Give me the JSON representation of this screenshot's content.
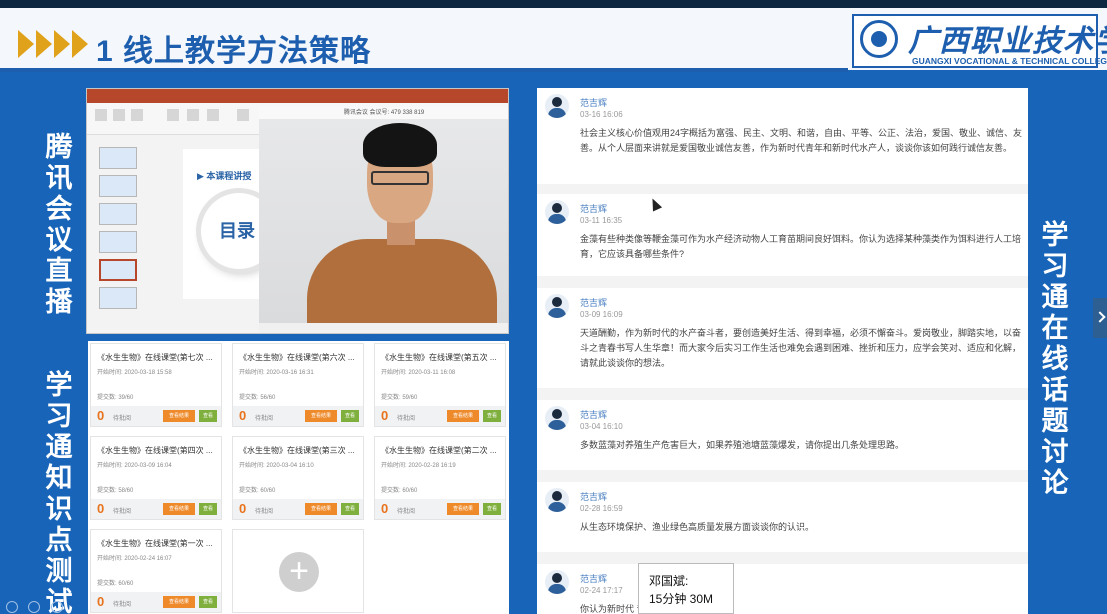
{
  "header": {
    "title": "1 线上教学方法策略",
    "logo_cn": "广西职业技术学院",
    "logo_en": "GUANGXI VOCATIONAL & TECHNICAL COLLEGE"
  },
  "labels": {
    "left_top": "腾讯会议直播",
    "left_bottom": "学习通知识点测试",
    "right": "学习通在线话题讨论"
  },
  "meeting": {
    "slide_heading": "▶ 本课程讲授",
    "slide_circle": "目录",
    "video_header": "腾讯会议 会议号: 479 338 819"
  },
  "quiz": {
    "cards": [
      {
        "title": "《水生生物》在线课堂(第七次 ...",
        "time": "开始时间: 2020-03-18 15:58",
        "sub": "提交数: 39/60",
        "zero": "0",
        "pending": "待批阅",
        "btn1": "查看结果",
        "btn2": "查看"
      },
      {
        "title": "《水生生物》在线课堂(第六次 ...",
        "time": "开始时间: 2020-03-16 16:31",
        "sub": "提交数: 56/60",
        "zero": "0",
        "pending": "待批阅",
        "btn1": "查看结果",
        "btn2": "查看"
      },
      {
        "title": "《水生生物》在线课堂(第五次 ...",
        "time": "开始时间: 2020-03-11 16:08",
        "sub": "提交数: 59/60",
        "zero": "0",
        "pending": "待批阅",
        "btn1": "查看结果",
        "btn2": "查看"
      },
      {
        "title": "《水生生物》在线课堂(第四次 ...",
        "time": "开始时间: 2020-03-09 16:04",
        "sub": "提交数: 58/60",
        "zero": "0",
        "pending": "待批阅",
        "btn1": "查看结果",
        "btn2": "查看"
      },
      {
        "title": "《水生生物》在线课堂(第三次 ...",
        "time": "开始时间: 2020-03-04 16:10",
        "sub": "提交数: 60/60",
        "zero": "0",
        "pending": "待批阅",
        "btn1": "查看结果",
        "btn2": "查看"
      },
      {
        "title": "《水生生物》在线课堂(第二次 ...",
        "time": "开始时间: 2020-02-28 16:19",
        "sub": "提交数: 60/60",
        "zero": "0",
        "pending": "待批阅",
        "btn1": "查看结果",
        "btn2": "查看"
      },
      {
        "title": "《水生生物》在线课堂(第一次 ...",
        "time": "开始时间: 2020-02-24 16:07",
        "sub": "提交数: 60/60",
        "zero": "0",
        "pending": "待批阅",
        "btn1": "查看结果",
        "btn2": "查看"
      }
    ],
    "add_symbol": "+"
  },
  "discussion": {
    "posts": [
      {
        "name": "范吉辉",
        "date": "03-16 16:06",
        "text": "社会主义核心价值观用24字概括为富强、民主、文明、和谐，自由、平等、公正、法治，爱国、敬业、诚信、友善。从个人层面来讲就是爱国敬业诚信友善，作为新时代青年和新时代水产人，谈谈你该如何践行诚信友善。"
      },
      {
        "name": "范吉辉",
        "date": "03-11 16:35",
        "text": "金藻有些种类像等鞭金藻可作为水产经济动物人工育苗期间良好饵料。你认为选择某种藻类作为饵料进行人工培育，它应该具备哪些条件?"
      },
      {
        "name": "范吉辉",
        "date": "03-09 16:09",
        "text": "天道酬勤，作为新时代的水产奋斗者，要创造美好生活、得到幸福，必须不懈奋斗。爱岗敬业，脚踏实地，以奋斗之青春书写人生华章！而大家今后实习工作生活也难免会遇到困难、挫折和压力，应学会笑对、适应和化解，请就此谈谈你的想法。"
      },
      {
        "name": "范吉辉",
        "date": "03-04 16:10",
        "text": "多数蓝藻对养殖生产危害巨大，如果养殖池塘蓝藻爆发，请你提出几条处理思路。"
      },
      {
        "name": "范吉辉",
        "date": "02-28 16:59",
        "text": "从生态环境保护、渔业绿色高质量发展方面谈谈你的认识。"
      },
      {
        "name": "范吉辉",
        "date": "02-24 17:17",
        "text": "你认为新时代                    音?"
      }
    ]
  },
  "tooltip": {
    "line1": "邓国斌:",
    "line2": "15分钟 30M"
  },
  "colors": {
    "background": "#1764b8",
    "brand_blue": "#1d5fae",
    "accent_gold": "#e0a21b",
    "quiz_orange": "#ee8a2a",
    "quiz_green": "#7fb03e"
  }
}
